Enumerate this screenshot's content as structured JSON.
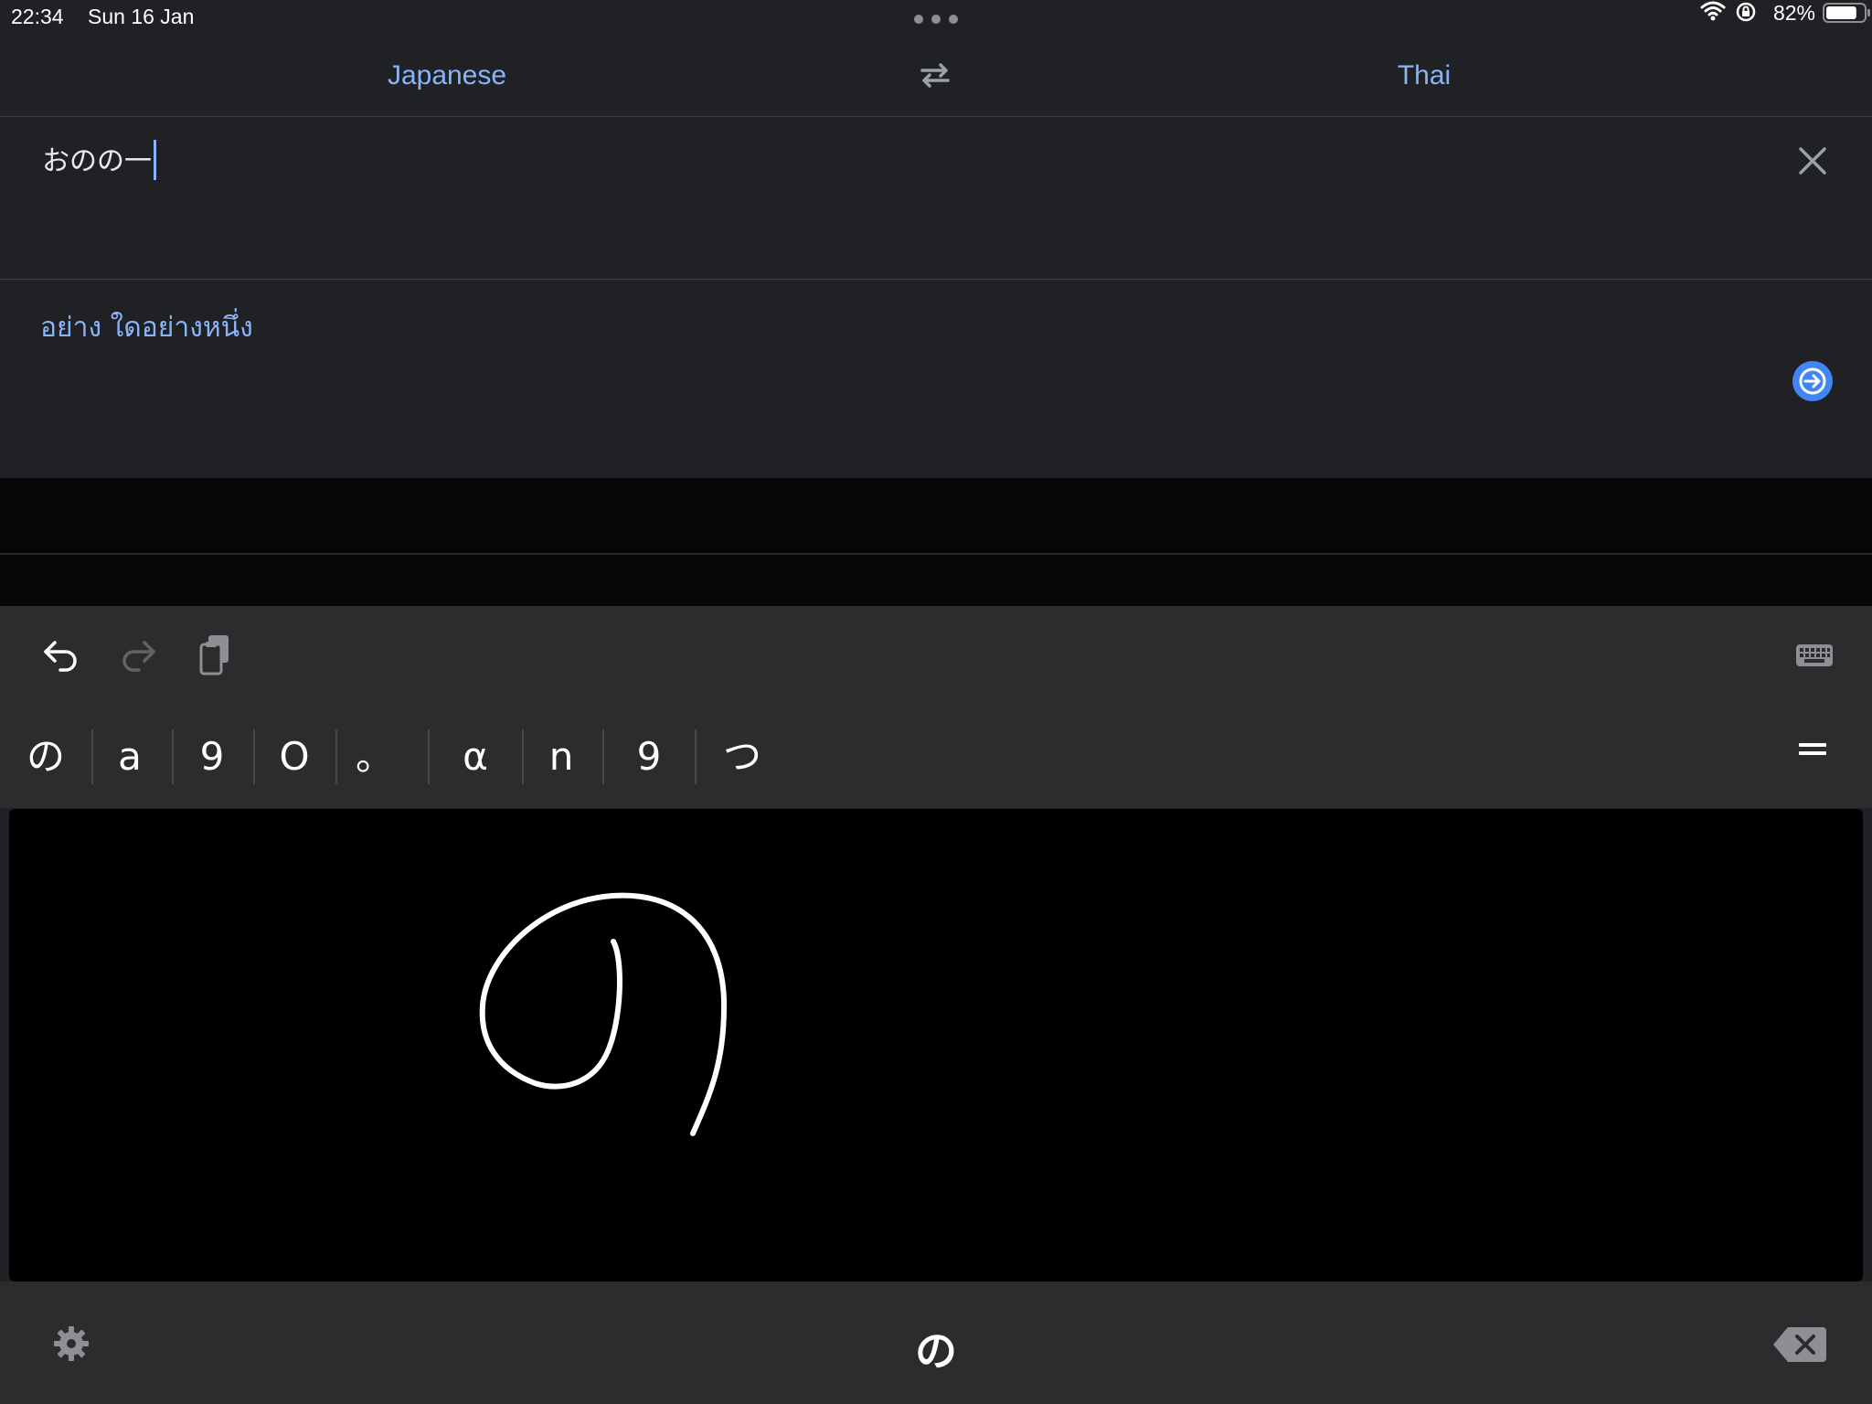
{
  "status_bar": {
    "time": "22:34",
    "date": "Sun 16 Jan",
    "battery_percent": "82%",
    "battery_level": 0.82,
    "icons": [
      "wifi-icon",
      "orientation-lock-icon",
      "battery-icon"
    ]
  },
  "languages": {
    "source": "Japanese",
    "target": "Thai",
    "swap_icon": "swap-arrows-icon"
  },
  "input": {
    "text": "おのの一",
    "clear_icon": "close-icon"
  },
  "output": {
    "translation": "อย่าง ใดอย่างหนึ่ง",
    "go_icon": "arrow-right-icon"
  },
  "toolbar": {
    "icons": [
      "undo-icon",
      "redo-icon",
      "paste-icon",
      "keyboard-icon"
    ]
  },
  "candidates": {
    "items": [
      "の",
      "a",
      "9",
      "O",
      "。",
      "α",
      "n",
      "9",
      "つ"
    ],
    "more_icon": "more-candidates-icon"
  },
  "handwriting": {
    "drawn_character": "の"
  },
  "bottom_bar": {
    "candidate": "の",
    "icons": [
      "gear-icon",
      "backspace-icon"
    ]
  },
  "colors": {
    "accent": "#8ab4f8",
    "button_blue": "#4285f4",
    "background": "#202124",
    "keyboard": "#2c2c2e",
    "canvas": "#000000"
  }
}
